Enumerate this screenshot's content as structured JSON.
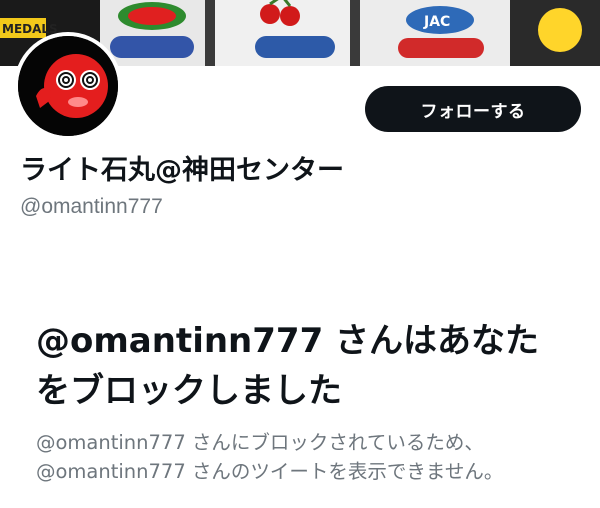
{
  "banner": {
    "visible_text": [
      "MEDALS",
      "JAC"
    ]
  },
  "profile": {
    "display_name": "ライト石丸@神田センター",
    "handle": "@omantinn777",
    "follow_label": "フォローする"
  },
  "blocked_notice": {
    "title": "@omantinn777 さんはあなたをブロックしました",
    "desc_line1": "@omantinn777 さんにブロックされているため、",
    "desc_line2": "@omantinn777 さんのツイートを表示できません。"
  },
  "colors": {
    "text_primary": "#0f1419",
    "text_secondary": "#6e767d",
    "button_bg": "#0f1419",
    "button_text": "#ffffff",
    "avatar_face": "#e41e1e"
  }
}
